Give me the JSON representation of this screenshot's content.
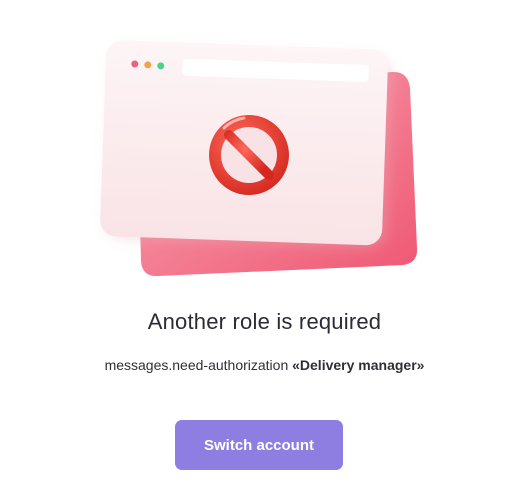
{
  "illustration": {
    "icon": "prohibited-browser-window-icon",
    "colors": {
      "back_card": "#f05f7a",
      "front_card": "#fbeaec",
      "prohibited_sign": "#e63a2e",
      "dot_red": "#f0607a",
      "dot_orange": "#f3a24a",
      "dot_green": "#4cd38a"
    }
  },
  "message": {
    "title": "Another role is required",
    "subtitle_prefix": "messages.need-authorization",
    "role_label": "«Delivery manager»"
  },
  "actions": {
    "switch_account_label": "Switch account",
    "button_color": "#8e7ee2"
  }
}
